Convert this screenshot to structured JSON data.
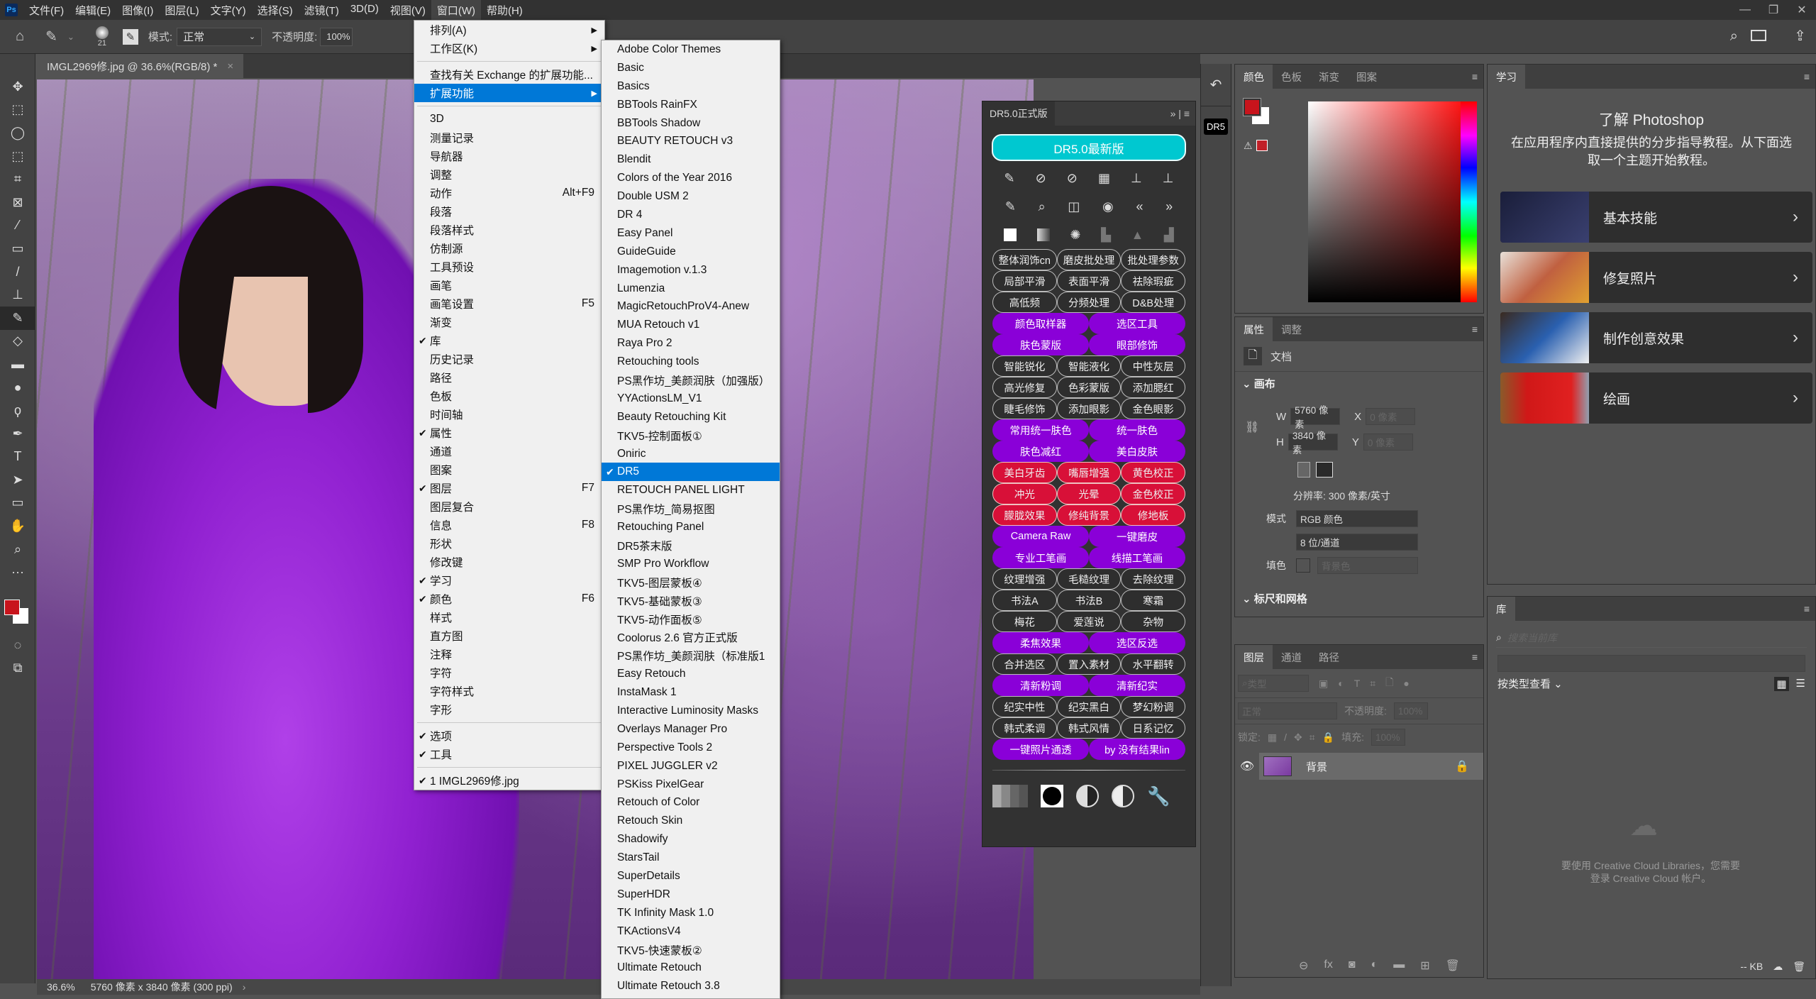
{
  "menubar": {
    "items": [
      "文件(F)",
      "编辑(E)",
      "图像(I)",
      "图层(L)",
      "文字(Y)",
      "选择(S)",
      "滤镜(T)",
      "3D(D)",
      "视图(V)",
      "窗口(W)",
      "帮助(H)"
    ],
    "active_index": 9
  },
  "options_bar": {
    "brush_size": "21",
    "mode_label": "模式:",
    "mode_value": "正常",
    "opacity_label": "不透明度:",
    "opacity_value": "100%"
  },
  "document_tab": {
    "title": "IMGL2969修.jpg @ 36.6%(RGB/8) *",
    "close": "×"
  },
  "status_bar": {
    "zoom": "36.6%",
    "info": "5760 像素 x 3840 像素 (300 ppi)"
  },
  "window_menu": {
    "items": [
      {
        "label": "排列(A)",
        "submenu": true
      },
      {
        "label": "工作区(K)",
        "submenu": true
      },
      {
        "sep": true
      },
      {
        "label": "查找有关 Exchange 的扩展功能..."
      },
      {
        "label": "扩展功能",
        "submenu": true,
        "highlighted": true
      },
      {
        "sep": true
      },
      {
        "label": "3D"
      },
      {
        "label": "测量记录"
      },
      {
        "label": "导航器"
      },
      {
        "label": "调整"
      },
      {
        "label": "动作",
        "shortcut": "Alt+F9"
      },
      {
        "label": "段落"
      },
      {
        "label": "段落样式"
      },
      {
        "label": "仿制源"
      },
      {
        "label": "工具预设"
      },
      {
        "label": "画笔"
      },
      {
        "label": "画笔设置",
        "shortcut": "F5"
      },
      {
        "label": "渐变"
      },
      {
        "label": "库",
        "checked": true
      },
      {
        "label": "历史记录"
      },
      {
        "label": "路径"
      },
      {
        "label": "色板"
      },
      {
        "label": "时间轴"
      },
      {
        "label": "属性",
        "checked": true
      },
      {
        "label": "通道"
      },
      {
        "label": "图案"
      },
      {
        "label": "图层",
        "checked": true,
        "shortcut": "F7"
      },
      {
        "label": "图层复合"
      },
      {
        "label": "信息",
        "shortcut": "F8"
      },
      {
        "label": "形状"
      },
      {
        "label": "修改键"
      },
      {
        "label": "学习",
        "checked": true
      },
      {
        "label": "颜色",
        "checked": true,
        "shortcut": "F6"
      },
      {
        "label": "样式"
      },
      {
        "label": "直方图"
      },
      {
        "label": "注释"
      },
      {
        "label": "字符"
      },
      {
        "label": "字符样式"
      },
      {
        "label": "字形"
      },
      {
        "sep": true
      },
      {
        "label": "选项",
        "checked": true
      },
      {
        "label": "工具",
        "checked": true
      },
      {
        "sep": true
      },
      {
        "label": "1 IMGL2969修.jpg",
        "checked": true
      }
    ]
  },
  "extensions_menu": {
    "items": [
      {
        "label": "Adobe Color Themes"
      },
      {
        "label": "Basic"
      },
      {
        "label": "Basics"
      },
      {
        "label": "BBTools RainFX"
      },
      {
        "label": "BBTools Shadow"
      },
      {
        "label": "BEAUTY RETOUCH v3"
      },
      {
        "label": "Blendit"
      },
      {
        "label": "Colors of the Year 2016"
      },
      {
        "label": "Double USM 2"
      },
      {
        "label": "DR 4"
      },
      {
        "label": "Easy Panel"
      },
      {
        "label": "GuideGuide"
      },
      {
        "label": "Imagemotion v.1.3"
      },
      {
        "label": "Lumenzia"
      },
      {
        "label": "MagicRetouchProV4-Anew"
      },
      {
        "label": "MUA Retouch v1"
      },
      {
        "label": "Raya Pro 2"
      },
      {
        "label": "Retouching tools"
      },
      {
        "label": "PS黑作坊_美颜润肤（加强版）"
      },
      {
        "label": "YYActionsLM_V1"
      },
      {
        "label": "Beauty Retouching Kit"
      },
      {
        "label": "TKV5-控制面板①"
      },
      {
        "label": "Oniric"
      },
      {
        "label": "DR5",
        "checked": true,
        "highlighted": true
      },
      {
        "label": "RETOUCH PANEL LIGHT"
      },
      {
        "label": "PS黑作坊_简易抠图"
      },
      {
        "label": "Retouching Panel"
      },
      {
        "label": "DR5茶末版"
      },
      {
        "label": "SMP Pro Workflow"
      },
      {
        "label": "TKV5-图层蒙板④"
      },
      {
        "label": "TKV5-基础蒙板③"
      },
      {
        "label": "TKV5-动作面板⑤"
      },
      {
        "label": "Coolorus 2.6 官方正式版"
      },
      {
        "label": "PS黑作坊_美颜润肤（标准版1"
      },
      {
        "label": "Easy Retouch"
      },
      {
        "label": "InstaMask 1"
      },
      {
        "label": "Interactive Luminosity Masks"
      },
      {
        "label": "Overlays Manager Pro"
      },
      {
        "label": "Perspective Tools 2"
      },
      {
        "label": "PIXEL JUGGLER v2"
      },
      {
        "label": "PSKiss PixelGear"
      },
      {
        "label": "Retouch of Color"
      },
      {
        "label": "Retouch Skin"
      },
      {
        "label": "Shadowify"
      },
      {
        "label": "StarsTail"
      },
      {
        "label": "SuperDetails"
      },
      {
        "label": "SuperHDR"
      },
      {
        "label": "TK Infinity Mask 1.0"
      },
      {
        "label": "TKActionsV4"
      },
      {
        "label": "TKV5-快速蒙板②"
      },
      {
        "label": "Ultimate Retouch"
      },
      {
        "label": "Ultimate Retouch 3.8"
      }
    ]
  },
  "dr5_panel": {
    "tab_title": "DR5.0正式版",
    "top_button": "DR5.0最新版",
    "rows": [
      {
        "style": "outline",
        "labels": [
          "整体润饰cn",
          "磨皮批处理",
          "批处理参数"
        ]
      },
      {
        "style": "outline",
        "labels": [
          "局部平滑",
          "表面平滑",
          "祛除瑕疵"
        ]
      },
      {
        "style": "outline",
        "labels": [
          "高低频",
          "分频处理",
          "D&B处理"
        ]
      },
      {
        "style": "purple",
        "labels": [
          "颜色取样器",
          "选区工具"
        ]
      },
      {
        "style": "purple",
        "labels": [
          "肤色蒙版",
          "眼部修饰"
        ]
      },
      {
        "style": "outline",
        "labels": [
          "智能锐化",
          "智能液化",
          "中性灰层"
        ]
      },
      {
        "style": "outline",
        "labels": [
          "高光修复",
          "色彩蒙版",
          "添加腮红"
        ]
      },
      {
        "style": "outline",
        "labels": [
          "睫毛修饰",
          "添加眼影",
          "金色眼影"
        ]
      },
      {
        "style": "purple",
        "labels": [
          "常用统一肤色",
          "统一肤色"
        ]
      },
      {
        "style": "purple",
        "labels": [
          "肤色减红",
          "美白皮肤"
        ]
      },
      {
        "style": "red",
        "labels": [
          "美白牙齿",
          "嘴唇增强",
          "黄色校正"
        ]
      },
      {
        "style": "red",
        "labels": [
          "冲光",
          "光晕",
          "金色校正"
        ]
      },
      {
        "style": "red",
        "labels": [
          "朦胧效果",
          "修纯背景",
          "修地板"
        ]
      },
      {
        "style": "purple",
        "labels": [
          "Camera Raw",
          "一键磨皮"
        ]
      },
      {
        "style": "purple",
        "labels": [
          "专业工笔画",
          "线描工笔画"
        ]
      },
      {
        "style": "outline",
        "labels": [
          "纹理增强",
          "毛糙纹理",
          "去除纹理"
        ]
      },
      {
        "style": "outline",
        "labels": [
          "书法A",
          "书法B",
          "寒霜"
        ]
      },
      {
        "style": "outline",
        "labels": [
          "梅花",
          "爱莲说",
          "杂物"
        ]
      },
      {
        "style": "purple",
        "labels": [
          "柔焦效果",
          "选区反选"
        ]
      },
      {
        "style": "outline",
        "labels": [
          "合并选区",
          "置入素材",
          "水平翻转"
        ]
      },
      {
        "style": "purple",
        "labels": [
          "清新粉调",
          "清新纪实"
        ]
      },
      {
        "style": "outline",
        "labels": [
          "纪实中性",
          "纪实黑白",
          "梦幻粉调"
        ]
      },
      {
        "style": "outline",
        "labels": [
          "韩式柔调",
          "韩式风情",
          "日系记忆"
        ]
      },
      {
        "style": "purple",
        "labels": [
          "一键照片通透",
          "by 没有结果lin"
        ]
      }
    ],
    "colors": {
      "cyan": "#00c8d0",
      "purple": "#8a00d8",
      "red": "#d81038"
    }
  },
  "color_panel": {
    "tabs": [
      "颜色",
      "色板",
      "渐变",
      "图案"
    ],
    "foreground": "#c8141c",
    "background": "#ffffff"
  },
  "properties_panel": {
    "tabs": [
      "属性",
      "调整"
    ],
    "doc_label": "文档",
    "canvas_section": "画布",
    "w_label": "W",
    "w_value": "5760 像素",
    "h_label": "H",
    "h_value": "3840 像素",
    "x_label": "X",
    "x_value": "0 像素",
    "y_label": "Y",
    "y_value": "0 像素",
    "resolution": "分辨率: 300 像素/英寸",
    "mode_label": "模式",
    "mode_value": "RGB 颜色",
    "depth_value": "8 位/通道",
    "fill_label": "填色",
    "fill_value": "背景色",
    "rulers_section": "标尺和网格"
  },
  "layers_panel": {
    "tabs": [
      "图层",
      "通道",
      "路径"
    ],
    "filter_label": "类型",
    "blend_mode": "正常",
    "opacity_label": "不透明度:",
    "opacity_value": "100%",
    "lock_label": "锁定:",
    "fill_label": "填充:",
    "fill_value": "100%",
    "layers": [
      {
        "name": "背景",
        "visible": true,
        "locked": true
      }
    ]
  },
  "learn_panel": {
    "tab": "学习",
    "title": "了解 Photoshop",
    "subtitle": "在应用程序内直接提供的分步指导教程。从下面选取一个主题开始教程。",
    "cards": [
      "基本技能",
      "修复照片",
      "制作创意效果",
      "绘画"
    ]
  },
  "library_panel": {
    "tab": "库",
    "search_placeholder": "搜索当前库",
    "view_by": "按类型查看",
    "message": "要使用 Creative Cloud Libraries，您需要登录 Creative Cloud 帐户。",
    "size": "-- KB"
  }
}
